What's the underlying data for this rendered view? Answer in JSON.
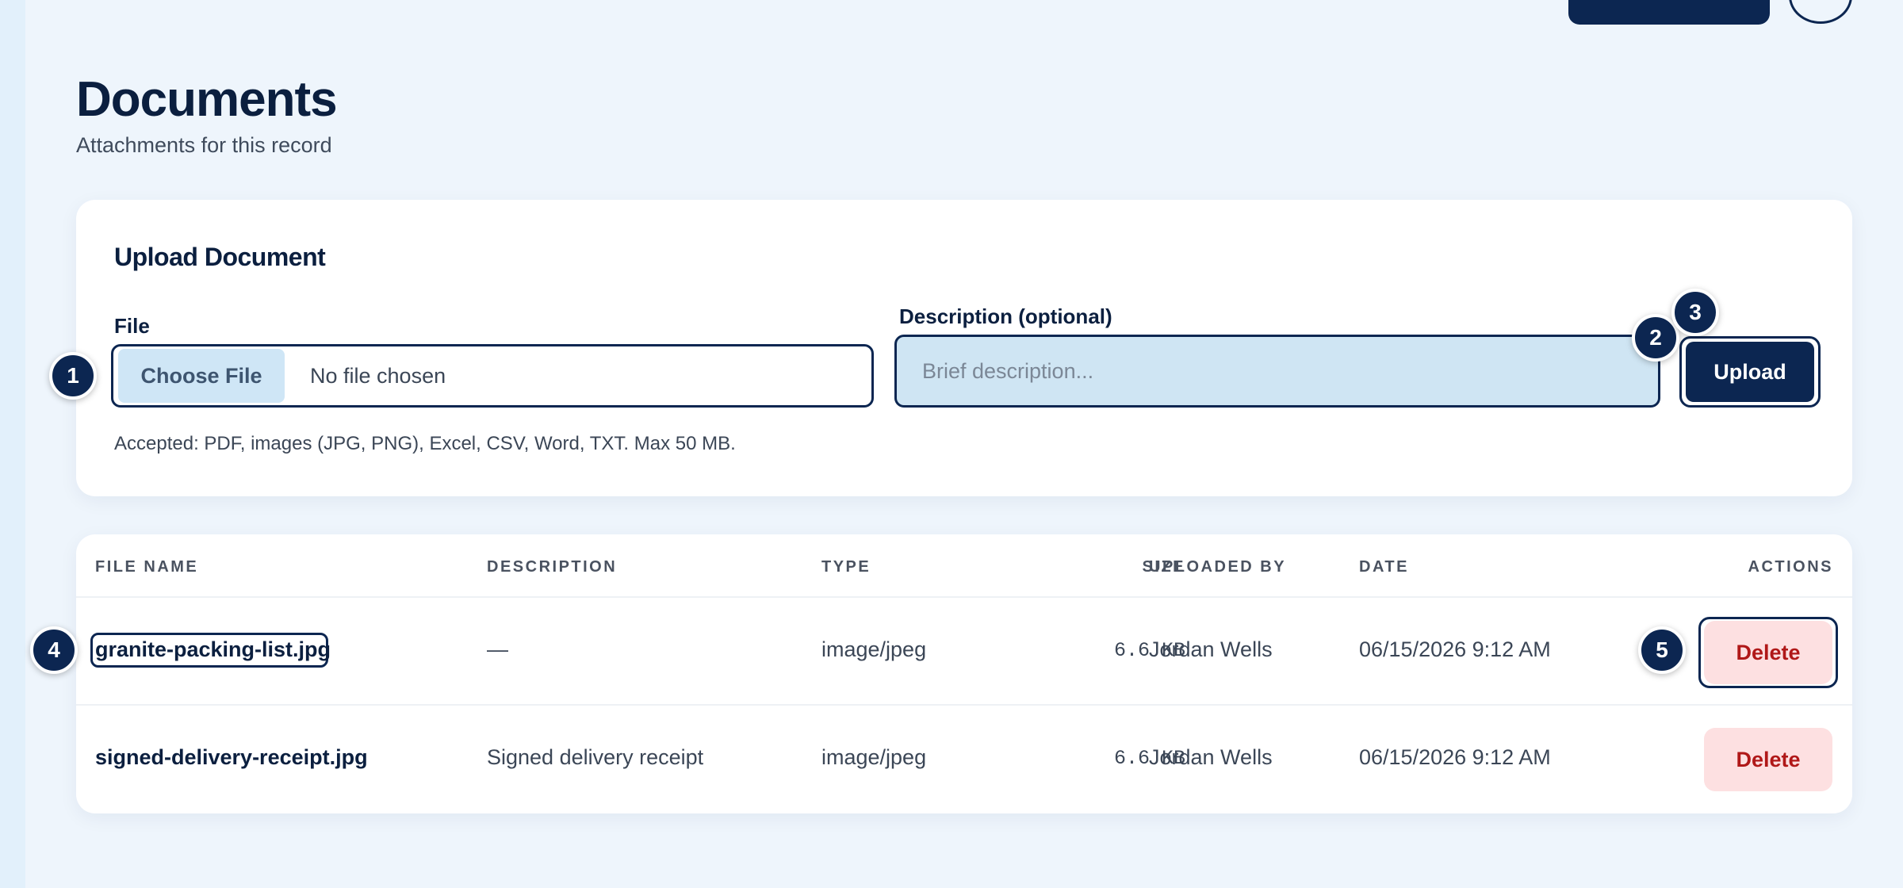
{
  "page": {
    "title": "Documents",
    "subtitle": "Attachments for this record"
  },
  "upload": {
    "title": "Upload Document",
    "file_label": "File",
    "choose_file_label": "Choose File",
    "file_status": "No file chosen",
    "description_label": "Description (optional)",
    "description_placeholder": "Brief description...",
    "description_value": "",
    "upload_label": "Upload",
    "hint": "Accepted: PDF, images (JPG, PNG), Excel, CSV, Word, TXT. Max 50 MB."
  },
  "table": {
    "columns": [
      "FILE NAME",
      "DESCRIPTION",
      "TYPE",
      "SIZE",
      "UPLOADED BY",
      "DATE",
      "ACTIONS"
    ],
    "rows": [
      {
        "file_name": "granite-packing-list.jpg",
        "description": "—",
        "type": "image/jpeg",
        "size": "6.6 KB",
        "uploaded_by": "Jordan Wells",
        "date": "06/15/2026 9:12 AM",
        "action": "Delete"
      },
      {
        "file_name": "signed-delivery-receipt.jpg",
        "description": "Signed delivery receipt",
        "type": "image/jpeg",
        "size": "6.6 KB",
        "uploaded_by": "Jordan Wells",
        "date": "06/15/2026 9:12 AM",
        "action": "Delete"
      }
    ]
  },
  "markers": [
    "1",
    "2",
    "3",
    "4",
    "5"
  ],
  "colors": {
    "primary": "#0c2651",
    "background": "#eef5fc",
    "input_fill": "#cfe5f3",
    "danger_bg": "#fde0e1",
    "danger_text": "#b01818"
  }
}
